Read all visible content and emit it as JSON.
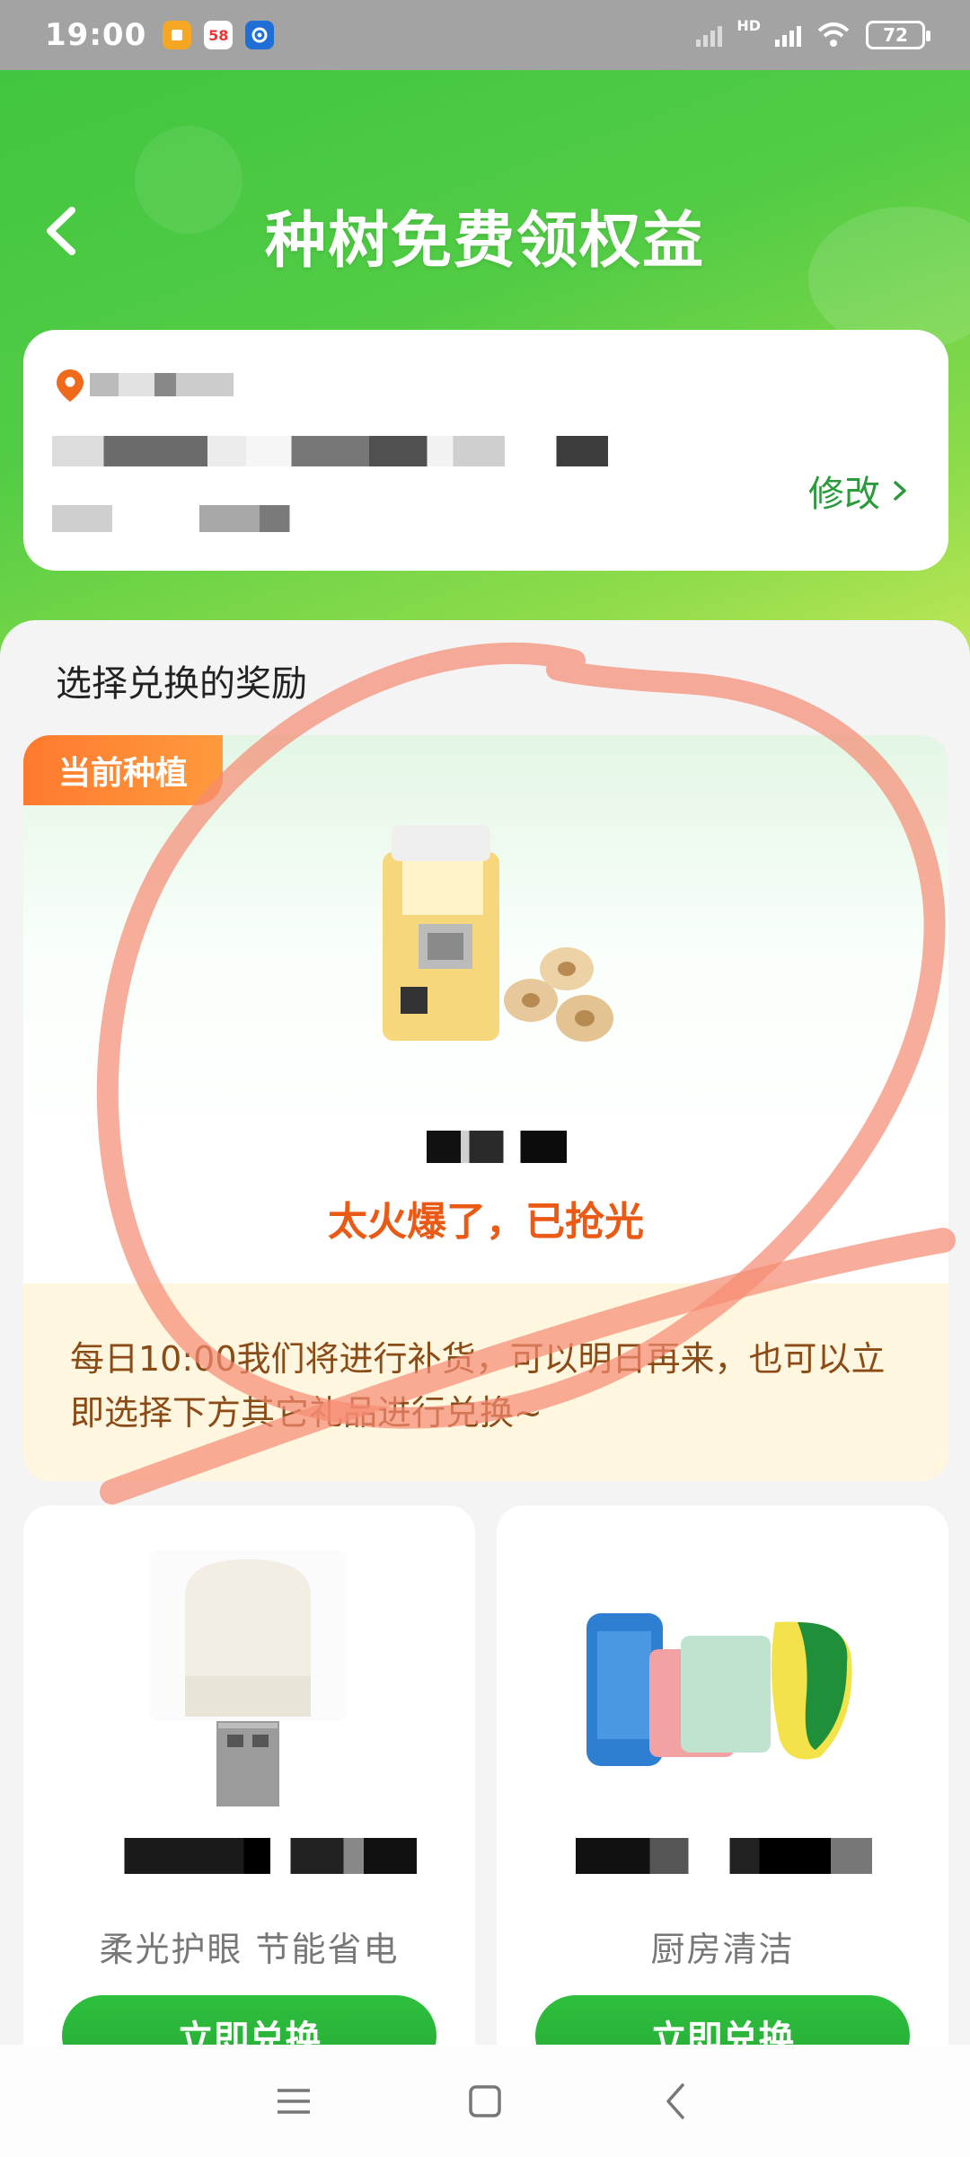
{
  "status_bar": {
    "time": "19:00",
    "apps": [
      {
        "name": "notes-app-icon",
        "label": "",
        "bg": "#f5a623"
      },
      {
        "name": "58-app-icon",
        "label": "58",
        "bg": "#ffffff"
      },
      {
        "name": "browser-app-icon",
        "label": "",
        "bg": "#1f6fd6"
      }
    ],
    "network_label": "HD",
    "battery": "72"
  },
  "header": {
    "title": "种树免费领权益"
  },
  "address_card": {
    "modify_label": "修改"
  },
  "rewards": {
    "section_title": "选择兑换的奖励",
    "featured": {
      "tag": "当前种植",
      "status": "太火爆了，已抢光",
      "notice": "每日10:00我们将进行补货，可以明日再来，也可以立即选择下方其它礼品进行兑换~"
    },
    "gifts": [
      {
        "desc": "柔光护眼 节能省电",
        "button": "立即兑换"
      },
      {
        "desc": "厨房清洁",
        "button": "立即兑换"
      }
    ]
  },
  "colors": {
    "brand_green": "#2a9a3a",
    "accent_orange": "#ea5a14",
    "button_green": "#24ab34"
  }
}
